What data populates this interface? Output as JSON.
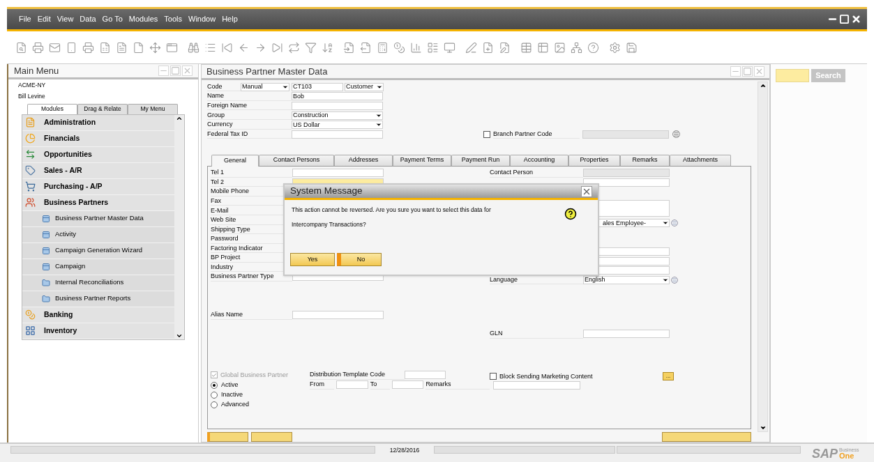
{
  "menu_bar": [
    "File",
    "Edit",
    "View",
    "Data",
    "Go To",
    "Modules",
    "Tools",
    "Window",
    "Help"
  ],
  "main_menu": {
    "title": "Main Menu",
    "company": "ACME-NY",
    "user": "Bill Levine",
    "tabs": [
      {
        "label": "Modules",
        "selected": true
      },
      {
        "label": "Drag & Relate",
        "selected": false
      },
      {
        "label": "My Menu",
        "selected": false
      }
    ],
    "modules": [
      {
        "label": "Administration"
      },
      {
        "label": "Financials"
      },
      {
        "label": "Opportunities"
      },
      {
        "label": "Sales - A/R"
      },
      {
        "label": "Purchasing - A/P"
      },
      {
        "label": "Business Partners",
        "children": [
          {
            "label": "Business Partner Master Data",
            "kind": "form"
          },
          {
            "label": "Activity",
            "kind": "form"
          },
          {
            "label": "Campaign Generation Wizard",
            "kind": "form"
          },
          {
            "label": "Campaign",
            "kind": "form"
          },
          {
            "label": "Internal Reconciliations",
            "kind": "folder"
          },
          {
            "label": "Business Partner Reports",
            "kind": "folder"
          }
        ]
      },
      {
        "label": "Banking"
      },
      {
        "label": "Inventory"
      }
    ]
  },
  "form": {
    "title": "Business Partner Master Data",
    "header": {
      "code_label": "Code",
      "series": "Manual",
      "code": "CT103",
      "type": "Customer",
      "rows": [
        {
          "label": "Name",
          "value": "Bob",
          "kind": "text"
        },
        {
          "label": "Foreign Name",
          "value": "",
          "kind": "text"
        },
        {
          "label": "Group",
          "value": "Construction",
          "kind": "dropdown"
        },
        {
          "label": "Currency",
          "value": "US Dollar",
          "kind": "dropdown"
        },
        {
          "label": "Federal Tax ID",
          "value": "",
          "kind": "text"
        }
      ],
      "branch": {
        "label": "Branch Partner Code",
        "checked": false
      }
    },
    "tabs": [
      {
        "label": "General",
        "selected": true
      },
      {
        "label": "Contact Persons",
        "selected": false
      },
      {
        "label": "Addresses",
        "selected": false
      },
      {
        "label": "Payment Terms",
        "selected": false
      },
      {
        "label": "Payment Run",
        "selected": false
      },
      {
        "label": "Accounting",
        "selected": false
      },
      {
        "label": "Properties",
        "selected": false
      },
      {
        "label": "Remarks",
        "selected": false
      },
      {
        "label": "Attachments",
        "selected": false
      }
    ],
    "general": {
      "left": [
        {
          "label": "Tel 1",
          "kind": "text"
        },
        {
          "label": "Tel 2",
          "kind": "focused"
        },
        {
          "label": "Mobile Phone",
          "kind": "label"
        },
        {
          "label": "Fax",
          "kind": "label"
        },
        {
          "label": "E-Mail",
          "kind": "label"
        },
        {
          "label": "Web Site",
          "kind": "label"
        },
        {
          "label": "Shipping Type",
          "kind": "label"
        },
        {
          "label": "Password",
          "kind": "label"
        },
        {
          "label": "Factoring Indicator",
          "kind": "label"
        },
        {
          "label": "BP Project",
          "kind": "label"
        },
        {
          "label": "Industry",
          "kind": "label"
        },
        {
          "label": "Business Partner Type",
          "kind": "text"
        }
      ],
      "contact_person": "Contact Person",
      "sales_employee": "ales Employee-",
      "language_label": "Language",
      "language": "English",
      "alias_label": "Alias Name",
      "gln_label": "GLN",
      "global_bp": {
        "label": "Global Business Partner",
        "checked": true,
        "disabled": true
      },
      "status_options": [
        {
          "label": "Active",
          "selected": true
        },
        {
          "label": "Inactive",
          "selected": false
        },
        {
          "label": "Advanced",
          "selected": false
        }
      ],
      "distribution_label": "Distribution Template Code",
      "from_label": "From",
      "to_label": "To",
      "remarks_label": "Remarks",
      "block_marketing": {
        "label": "Block Sending Marketing Content",
        "checked": false
      },
      "more_button": "..."
    }
  },
  "dialog": {
    "title": "System Message",
    "message_lines": [
      "This action cannot be reversed. Are you sure you want to select this data for",
      "Intercompany Transactions?"
    ],
    "buttons": [
      {
        "label": "Yes",
        "selected": false
      },
      {
        "label": "No",
        "selected": true
      }
    ]
  },
  "search": {
    "button": "Search"
  },
  "status_bar": {
    "date": "12/28/2016",
    "logo": {
      "brand": "SAP",
      "line1": "Business",
      "line2": "One"
    }
  }
}
